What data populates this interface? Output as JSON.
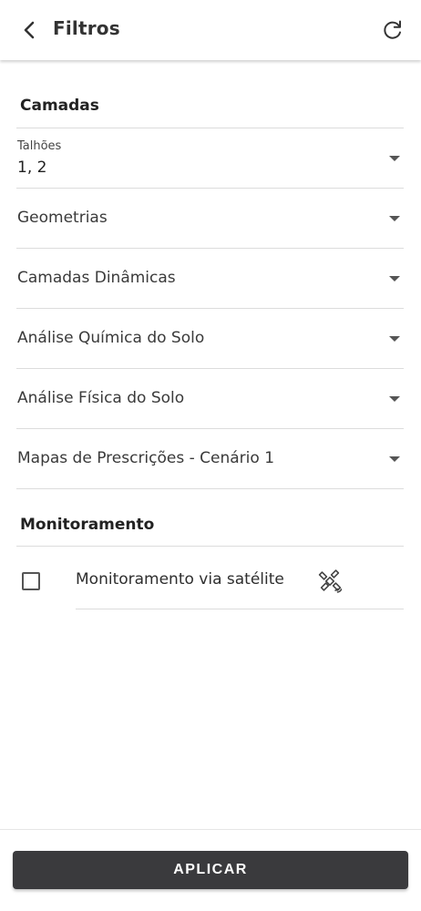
{
  "header": {
    "title": "Filtros",
    "back_icon": "chevron-left-icon",
    "reset_icon": "refresh-icon"
  },
  "sections": {
    "camadas_title": "Camadas",
    "monitoramento_title": "Monitoramento"
  },
  "selects": {
    "talhoes": {
      "label": "Talhões",
      "value": "1, 2"
    },
    "geometrias": {
      "label": "Geometrias"
    },
    "camadas_dinamicas": {
      "label": "Camadas Dinâmicas"
    },
    "analise_quimica": {
      "label": "Análise Química do Solo"
    },
    "analise_fisica": {
      "label": "Análise Física do Solo"
    },
    "mapas_prescricoes": {
      "label": "Mapas de Prescrições - Cenário 1"
    }
  },
  "monitoring": {
    "satellite_label": "Monitoramento via satélite",
    "checked": false,
    "icon": "satellite-icon"
  },
  "footer": {
    "apply_label": "APLICAR"
  },
  "colors": {
    "button_bg": "#3a3a3d",
    "divider": "#dcdcdc"
  }
}
